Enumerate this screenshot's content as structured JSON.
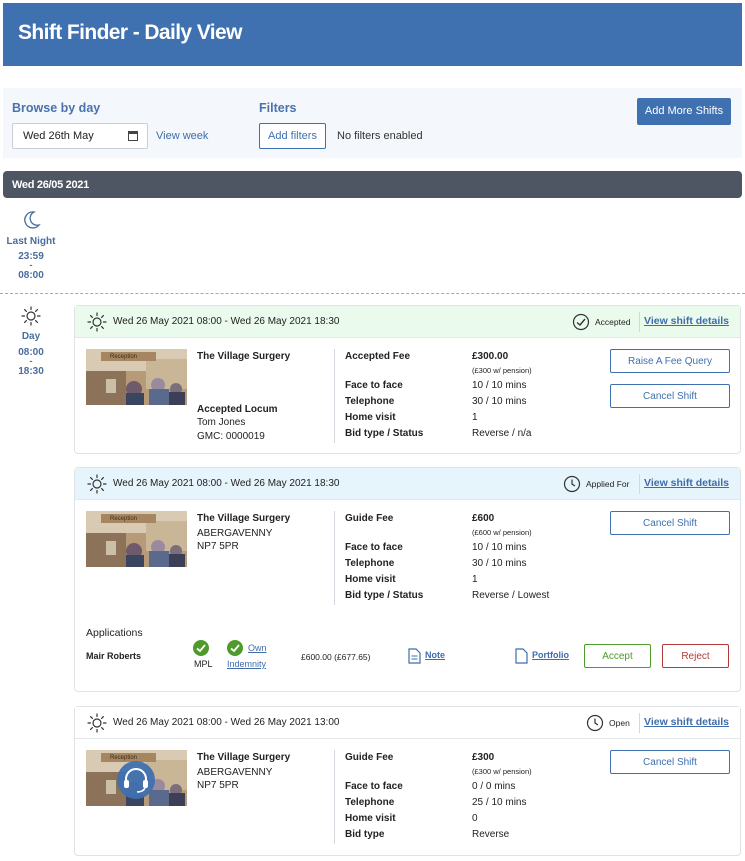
{
  "app": {
    "title": "Shift Finder - Daily View"
  },
  "filters": {
    "browse_label": "Browse by day",
    "date_value": "Wed 26th May",
    "view_week": "View week",
    "filters_label": "Filters",
    "add_filters": "Add filters",
    "no_filters": "No filters enabled",
    "add_more_shifts": "Add More Shifts"
  },
  "day_bar": {
    "label": "Wed 26/05 2021"
  },
  "last_night": {
    "label": "Last Night",
    "start": "23:59",
    "dash": "-",
    "end": "08:00"
  },
  "day_period": {
    "label": "Day",
    "start": "08:00",
    "dash": "-",
    "end": "18:30"
  },
  "shifts": [
    {
      "time": "Wed 26 May 2021 08:00 - Wed 26 May 2021 18:30",
      "status": "Accepted",
      "view_details": "View shift details",
      "thumb_text": "Reception",
      "practice": "The Village Surgery",
      "locum_label": "Accepted Locum",
      "locum_name": "Tom Jones",
      "locum_gmc": "GMC: 0000019",
      "fee_label": "Accepted Fee",
      "fee": "£300.00",
      "fee_note": "(£300 w/ pension)",
      "face_label": "Face to face",
      "face": "10 / 10 mins",
      "tel_label": "Telephone",
      "tel": "30 / 10 mins",
      "home_label": "Home visit",
      "home": "1",
      "bid_label": "Bid type / Status",
      "bid": "Reverse / n/a",
      "btn1": "Raise A Fee Query",
      "btn2": "Cancel Shift",
      "header_color": "#eafaec"
    },
    {
      "time": "Wed 26 May 2021 08:00 - Wed 26 May 2021 18:30",
      "status": "Applied For",
      "view_details": "View shift details",
      "thumb_text": "Reception",
      "practice": "The Village Surgery",
      "addr1": "ABERGAVENNY",
      "addr2": "NP7 5PR",
      "fee_label": "Guide Fee",
      "fee": "£600",
      "fee_note": "(£600 w/ pension)",
      "face_label": "Face to face",
      "face": "10 / 10 mins",
      "tel_label": "Telephone",
      "tel": "30 / 10 mins",
      "home_label": "Home visit",
      "home": "1",
      "bid_label": "Bid type / Status",
      "bid": "Reverse / Lowest",
      "btn1": "Cancel Shift",
      "header_color": "#e6f4fb",
      "applications": {
        "label": "Applications",
        "name": "Mair Roberts",
        "mpl": "MPL",
        "own": "Own",
        "indemnity": "Indemnity",
        "amount": "£600.00 (£677.65)",
        "note": "Note",
        "portfolio": "Portfolio",
        "accept": "Accept",
        "reject": "Reject"
      }
    },
    {
      "time": "Wed 26 May 2021 08:00 - Wed 26 May 2021 13:00",
      "status": "Open",
      "view_details": "View shift details",
      "thumb_text": "Reception",
      "practice": "The Village Surgery",
      "addr1": "ABERGAVENNY",
      "addr2": "NP7 5PR",
      "fee_label": "Guide Fee",
      "fee": "£300",
      "fee_note": "(£300 w/ pension)",
      "face_label": "Face to face",
      "face": "0 / 0 mins",
      "tel_label": "Telephone",
      "tel": "25 / 10 mins",
      "home_label": "Home visit",
      "home": "0",
      "bid_label": "Bid type",
      "bid": "Reverse",
      "btn1": "Cancel Shift",
      "header_color": "#ffffff"
    }
  ],
  "colors": {
    "brand": "#3f70b0",
    "accept": "#4f9a2c",
    "reject": "#b23a3a",
    "day_bar": "#4e5663"
  },
  "icons": [
    "calendar-icon",
    "moon-icon",
    "sun-icon",
    "check-circle-icon",
    "clock-icon",
    "document-icon",
    "headset-icon"
  ]
}
